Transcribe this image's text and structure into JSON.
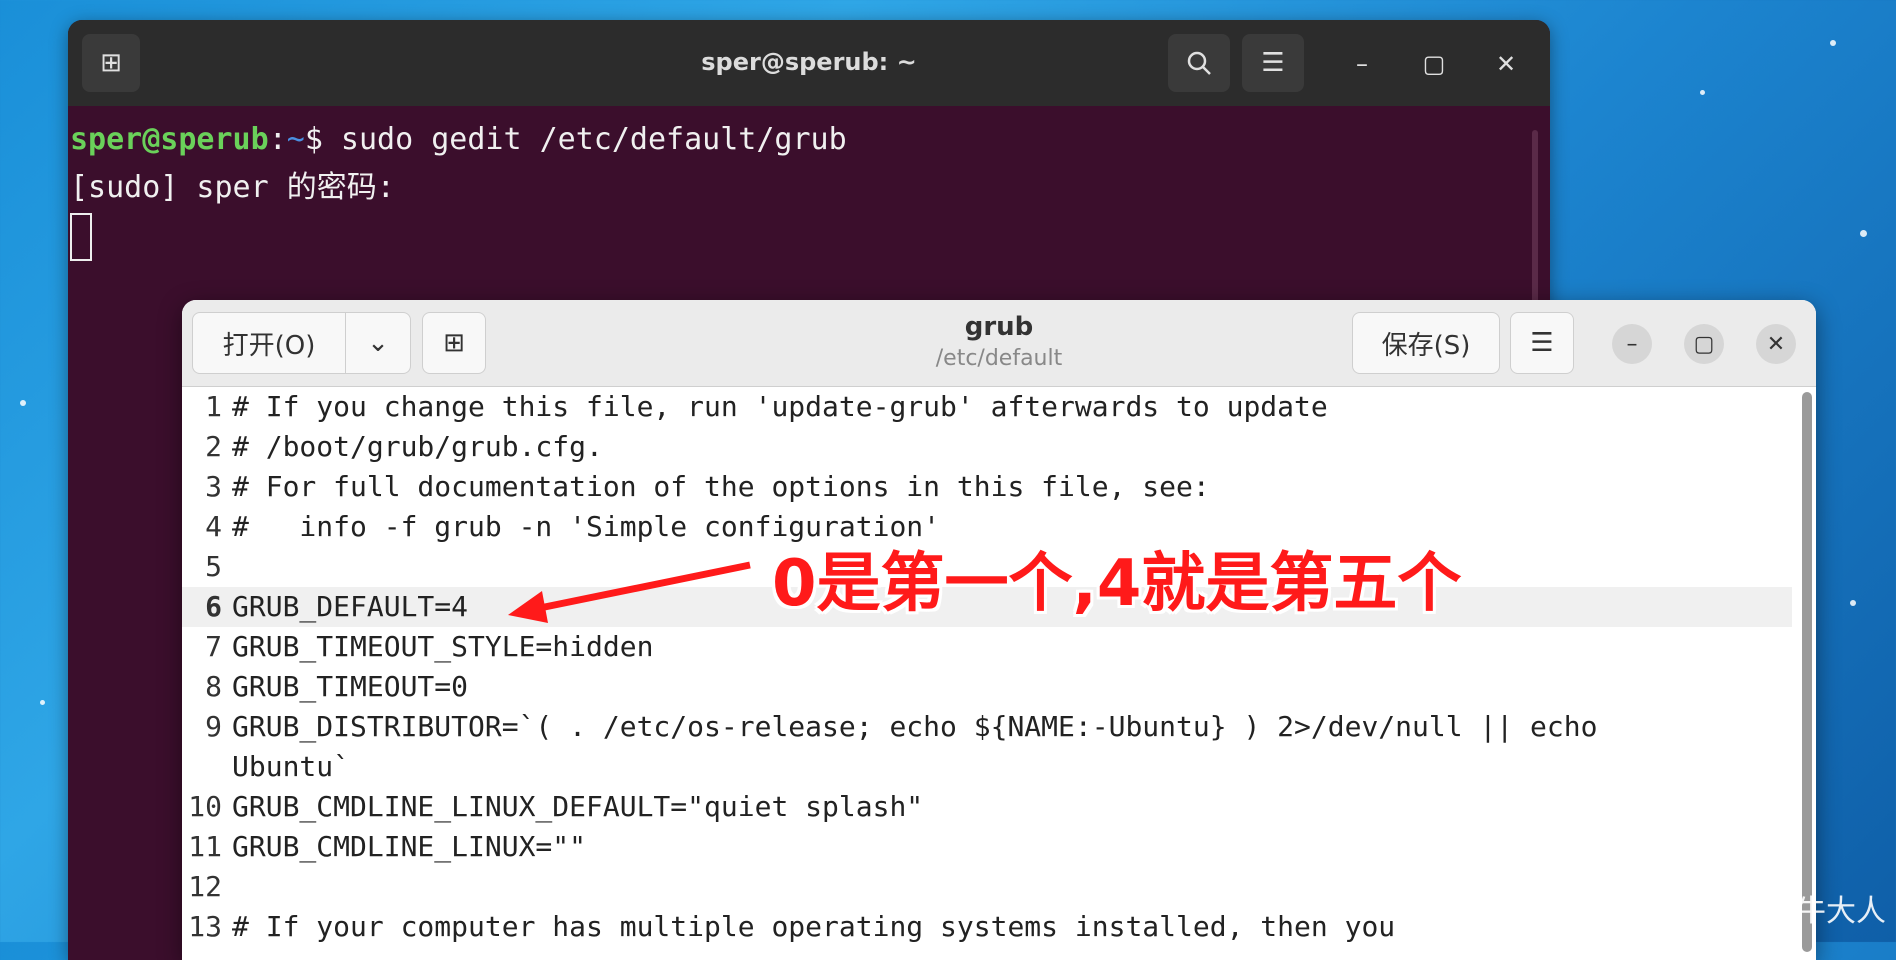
{
  "terminal": {
    "title": "sper@sperub: ~",
    "new_tab_icon": "new-tab-icon",
    "prompt_user": "sper@sperub",
    "prompt_sep": ":",
    "prompt_path": "~",
    "prompt_symbol": "$",
    "command": " sudo gedit /etc/default/grub",
    "sudo_prompt": "[sudo] sper 的密码:"
  },
  "gedit": {
    "open_label": "打开(O)",
    "save_label": "保存(S)",
    "title": "grub",
    "subtitle": "/etc/default",
    "lines": [
      {
        "n": "1",
        "text": "# If you change this file, run 'update-grub' afterwards to update"
      },
      {
        "n": "2",
        "text": "# /boot/grub/grub.cfg."
      },
      {
        "n": "3",
        "text": "# For full documentation of the options in this file, see:"
      },
      {
        "n": "4",
        "text": "#   info -f grub -n 'Simple configuration'"
      },
      {
        "n": "5",
        "text": ""
      },
      {
        "n": "6",
        "text": "GRUB_DEFAULT=4"
      },
      {
        "n": "7",
        "text": "GRUB_TIMEOUT_STYLE=hidden"
      },
      {
        "n": "8",
        "text": "GRUB_TIMEOUT=0"
      },
      {
        "n": "9",
        "text": "GRUB_DISTRIBUTOR=`( . /etc/os-release; echo ${NAME:-Ubuntu} ) 2>/dev/null || echo"
      },
      {
        "n": "",
        "text": "Ubuntu`"
      },
      {
        "n": "10",
        "text": "GRUB_CMDLINE_LINUX_DEFAULT=\"quiet splash\""
      },
      {
        "n": "11",
        "text": "GRUB_CMDLINE_LINUX=\"\""
      },
      {
        "n": "12",
        "text": ""
      },
      {
        "n": "13",
        "text": "# If your computer has multiple operating systems installed, then you"
      }
    ]
  },
  "annotation": "0是第一个,4就是第五个",
  "watermark": "CSDN @养牛大人",
  "colors": {
    "terminal_bg": "#3b0e2c",
    "prompt_user": "#6ad15a",
    "prompt_path": "#4a90e2",
    "annotation": "#ff1a1a"
  }
}
